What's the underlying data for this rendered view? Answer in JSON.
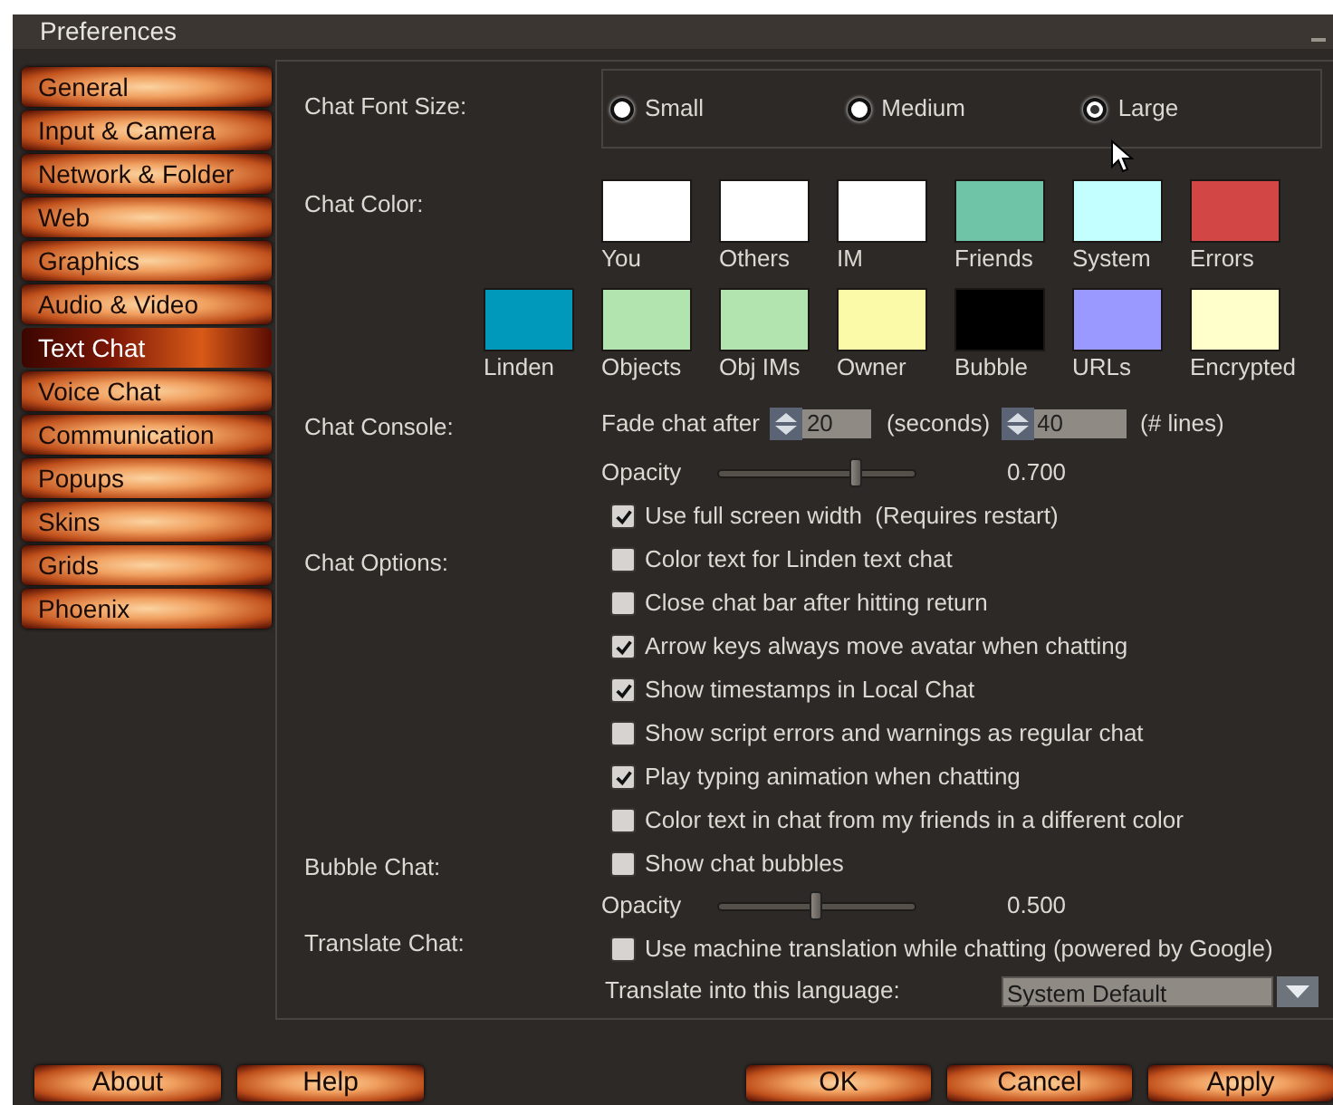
{
  "window": {
    "title": "Preferences"
  },
  "sidebar": {
    "items": [
      {
        "label": "General",
        "selected": false
      },
      {
        "label": "Input & Camera",
        "selected": false
      },
      {
        "label": "Network & Folder",
        "selected": false
      },
      {
        "label": "Web",
        "selected": false
      },
      {
        "label": "Graphics",
        "selected": false
      },
      {
        "label": "Audio & Video",
        "selected": false
      },
      {
        "label": "Text Chat",
        "selected": true
      },
      {
        "label": "Voice Chat",
        "selected": false
      },
      {
        "label": "Communication",
        "selected": false
      },
      {
        "label": "Popups",
        "selected": false
      },
      {
        "label": "Skins",
        "selected": false
      },
      {
        "label": "Grids",
        "selected": false
      },
      {
        "label": "Phoenix",
        "selected": false
      }
    ]
  },
  "chat_font_size": {
    "label": "Chat Font Size:",
    "options": [
      {
        "label": "Small",
        "selected": false
      },
      {
        "label": "Medium",
        "selected": false
      },
      {
        "label": "Large",
        "selected": true
      }
    ]
  },
  "chat_color": {
    "label": "Chat Color:",
    "swatches": [
      {
        "label": "You",
        "color": "#ffffff"
      },
      {
        "label": "Others",
        "color": "#ffffff"
      },
      {
        "label": "IM",
        "color": "#ffffff"
      },
      {
        "label": "Friends",
        "color": "#6fc4a8"
      },
      {
        "label": "System",
        "color": "#c4ffff"
      },
      {
        "label": "Errors",
        "color": "#d34646"
      },
      {
        "label": "Linden",
        "color": "#0099bb"
      },
      {
        "label": "Objects",
        "color": "#b2e4b0"
      },
      {
        "label": "Obj IMs",
        "color": "#b2e4b0"
      },
      {
        "label": "Owner",
        "color": "#fafaa8"
      },
      {
        "label": "Bubble",
        "color": "#000000"
      },
      {
        "label": "URLs",
        "color": "#9999ff"
      },
      {
        "label": "Encrypted",
        "color": "#ffffcc"
      }
    ]
  },
  "chat_console": {
    "label": "Chat Console:",
    "fade_prefix": "Fade chat after",
    "seconds": "20",
    "seconds_unit": "(seconds)",
    "lines": "40",
    "lines_unit": "(# lines)",
    "opacity": {
      "label": "Opacity",
      "level": 0.7,
      "reading": "0.700"
    }
  },
  "chat_options": {
    "label": "Chat Options:",
    "checkboxes": [
      {
        "label": "Use full screen width  (Requires restart)",
        "checked": true
      },
      {
        "label": "Color text for Linden text chat",
        "checked": false
      },
      {
        "label": "Close chat bar after hitting return",
        "checked": false
      },
      {
        "label": "Arrow keys always move avatar when chatting",
        "checked": true
      },
      {
        "label": "Show timestamps in Local Chat",
        "checked": true
      },
      {
        "label": "Show script errors and warnings as regular chat",
        "checked": false
      },
      {
        "label": "Play typing animation when chatting",
        "checked": true
      },
      {
        "label": "Color text in chat from my friends in a different color",
        "checked": false
      }
    ]
  },
  "bubble_chat": {
    "label": "Bubble Chat:",
    "checkbox": {
      "label": "Show chat bubbles",
      "checked": false
    },
    "opacity": {
      "label": "Opacity",
      "level": 0.5,
      "reading": "0.500"
    }
  },
  "translate_chat": {
    "label": "Translate Chat:",
    "checkbox": {
      "label": "Use machine translation while chatting (powered by Google)",
      "checked": false
    },
    "language_label": "Translate into this language:",
    "language": "System Default"
  },
  "footer": {
    "left_buttons": [
      "About",
      "Help"
    ],
    "right_buttons": [
      "OK",
      "Cancel",
      "Apply"
    ]
  }
}
